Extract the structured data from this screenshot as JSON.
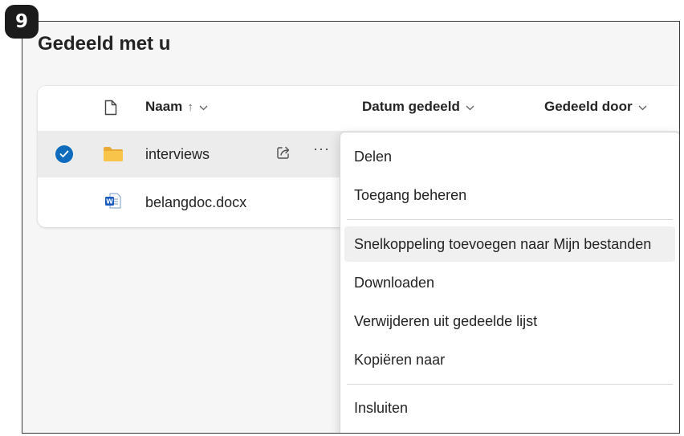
{
  "step": {
    "number": "9"
  },
  "page": {
    "title": "Gedeeld met u"
  },
  "columns": {
    "name_label": "Naam",
    "name_sort_arrow": "↑",
    "date_label": "Datum gedeeld",
    "shared_by_label": "Gedeeld door",
    "chevron": "⌄"
  },
  "files": [
    {
      "name": "interviews",
      "type": "folder",
      "selected": true,
      "icon": "folder-icon"
    },
    {
      "name": "belangdoc.docx",
      "type": "word",
      "selected": false,
      "icon": "word-doc-icon"
    }
  ],
  "row_actions": {
    "more": "···"
  },
  "context_menu": {
    "items": [
      {
        "label": "Delen"
      },
      {
        "label": "Toegang beheren"
      },
      {
        "label": "Snelkoppeling toevoegen naar Mijn bestanden",
        "hovered": true
      },
      {
        "label": "Downloaden"
      },
      {
        "label": "Verwijderen uit gedeelde lijst"
      },
      {
        "label": "Kopiëren naar"
      },
      {
        "label": "Insluiten"
      }
    ]
  },
  "colors": {
    "accent": "#0f6cbd",
    "folder": "#f8c44a",
    "word": "#185abd",
    "selected_row": "#ececec",
    "hover_item": "#f0f0f0"
  }
}
